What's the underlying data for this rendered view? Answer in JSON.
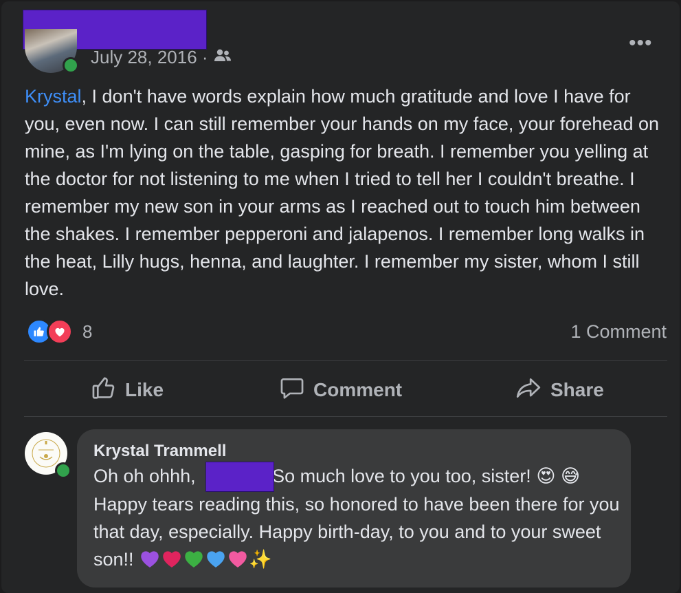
{
  "post": {
    "date": "July 28, 2016 ·",
    "audience_icon": "friends-icon",
    "more_icon": "more-horizontal-icon",
    "mention": "Krystal",
    "body": ", I don't have words explain how much gratitude and love I have for you, even now. I can still remember your hands on my face, your forehead on mine, as I'm lying on the table, gasping for breath. I remember you yelling at the doctor for not listening to me when I tried to tell her I couldn't breathe. I remember my new son in your arms as I reached out to touch him between the shakes. I remember pepperoni and jalapenos. I remember long walks in the heat, Lilly hugs, henna, and laughter. I remember my sister, whom I still love.",
    "reaction_count": "8",
    "comment_count": "1 Comment"
  },
  "actions": {
    "like": "Like",
    "comment": "Comment",
    "share": "Share"
  },
  "comment": {
    "author": "Krystal Trammell",
    "text_before": "Oh oh ohhh,",
    "text_after": " So much love to you too, sister! ",
    "emoji_1": "😍",
    "emoji_2": "😅",
    "text_2": " Happy tears reading this, so honored to have been there for you that day, especially. Happy birth-day, to you and to your sweet son!! ",
    "hearts": [
      "#9b51e0",
      "#e0245e",
      "#3cb043",
      "#4aa3f0",
      "#f25aa0"
    ],
    "sparkle": "✨"
  },
  "colors": {
    "accent": "#3e8ef7",
    "online": "#31a24c",
    "redaction": "#5b22c8"
  }
}
